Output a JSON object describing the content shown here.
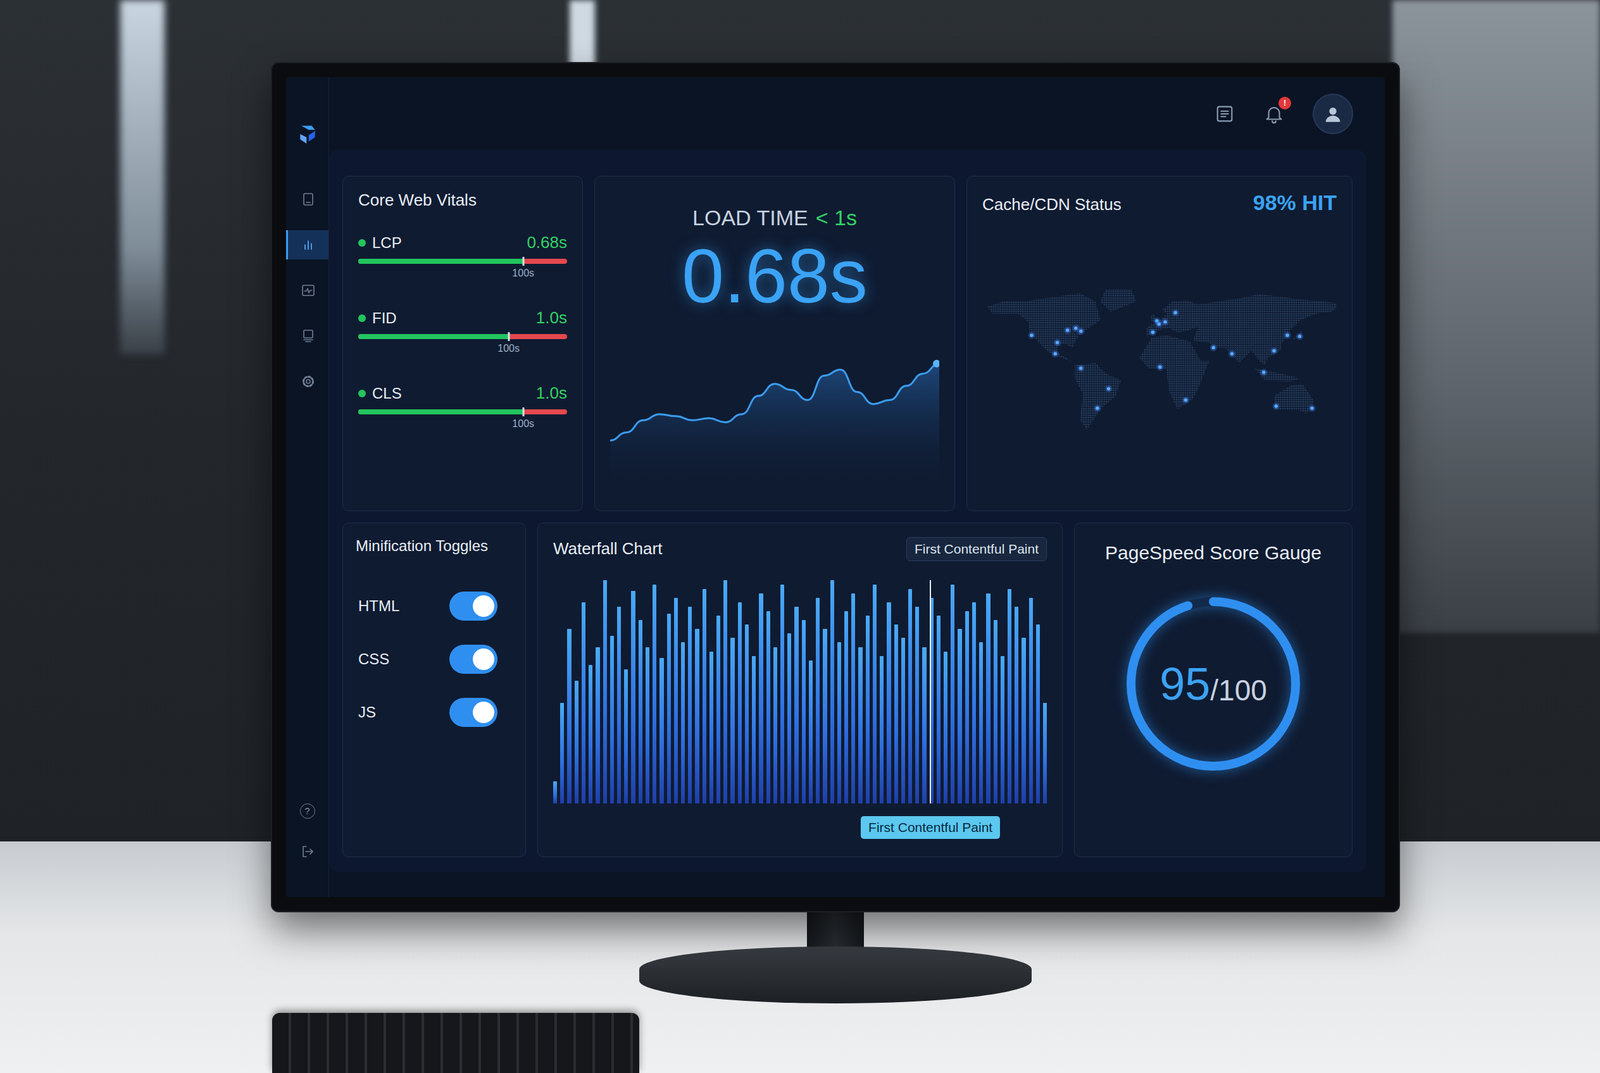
{
  "topbar": {
    "notification_badge": "!"
  },
  "sidebar": {
    "items": [
      {
        "selected": false
      },
      {
        "selected": true
      },
      {
        "selected": false
      },
      {
        "selected": false
      },
      {
        "selected": false
      }
    ],
    "help": "?"
  },
  "vitals": {
    "title": "Core Web Vitals",
    "metrics": [
      {
        "name": "LCP",
        "value": "0.68s",
        "tick": "100s",
        "level": 0.79
      },
      {
        "name": "FID",
        "value": "1.0s",
        "tick": "100s",
        "level": 0.72
      },
      {
        "name": "CLS",
        "value": "1.0s",
        "tick": "100s",
        "level": 0.79
      }
    ]
  },
  "load_time": {
    "label": "LOAD TIME",
    "target": "< 1s",
    "value": "0.68s",
    "series": [
      0.2,
      0.24,
      0.3,
      0.33,
      0.32,
      0.3,
      0.31,
      0.29,
      0.33,
      0.42,
      0.48,
      0.45,
      0.4,
      0.52,
      0.55,
      0.44,
      0.38,
      0.4,
      0.47,
      0.53,
      0.58
    ]
  },
  "cdn": {
    "title": "Cache/CDN Status",
    "hit_rate": "98% HIT",
    "pins": [
      {
        "lon": -122,
        "lat": 37
      },
      {
        "lon": -97,
        "lat": 30
      },
      {
        "lon": -87,
        "lat": 42
      },
      {
        "lon": -74,
        "lat": 41
      },
      {
        "lon": -79,
        "lat": 44
      },
      {
        "lon": -99,
        "lat": 19
      },
      {
        "lon": -74,
        "lat": 5
      },
      {
        "lon": -47,
        "lat": -15
      },
      {
        "lon": -58,
        "lat": -34
      },
      {
        "lon": 0,
        "lat": 51
      },
      {
        "lon": 2,
        "lat": 48
      },
      {
        "lon": 8,
        "lat": 50
      },
      {
        "lon": 18,
        "lat": 59
      },
      {
        "lon": -4,
        "lat": 40
      },
      {
        "lon": 3,
        "lat": 6
      },
      {
        "lon": 28,
        "lat": -26
      },
      {
        "lon": 55,
        "lat": 25
      },
      {
        "lon": 73,
        "lat": 19
      },
      {
        "lon": 104,
        "lat": 1
      },
      {
        "lon": 114,
        "lat": 22
      },
      {
        "lon": 139,
        "lat": 36
      },
      {
        "lon": 127,
        "lat": 37
      },
      {
        "lon": 151,
        "lat": -34
      },
      {
        "lon": 116,
        "lat": -32
      }
    ]
  },
  "minification": {
    "title": "Minification Toggles",
    "toggles": [
      {
        "label": "HTML",
        "on": true
      },
      {
        "label": "CSS",
        "on": true
      },
      {
        "label": "JS",
        "on": true
      }
    ]
  },
  "waterfall": {
    "title": "Waterfall Chart",
    "legend": "First Contentful Paint",
    "marker": {
      "label": "First Contentful Paint",
      "index": 53
    },
    "values": [
      10,
      45,
      78,
      55,
      90,
      62,
      70,
      100,
      75,
      88,
      60,
      95,
      82,
      70,
      98,
      65,
      85,
      92,
      72,
      88,
      78,
      96,
      68,
      84,
      100,
      74,
      90,
      80,
      66,
      94,
      86,
      70,
      98,
      76,
      88,
      82,
      64,
      92,
      78,
      100,
      72,
      86,
      94,
      70,
      84,
      98,
      66,
      90,
      80,
      74,
      96,
      88,
      70,
      92,
      84,
      68,
      98,
      78,
      86,
      90,
      72,
      94,
      82,
      66,
      96,
      88,
      74,
      92,
      80,
      45
    ]
  },
  "pagespeed": {
    "title": "PageSpeed Score Gauge",
    "score": "95",
    "max": "/100",
    "level": 0.95
  }
}
